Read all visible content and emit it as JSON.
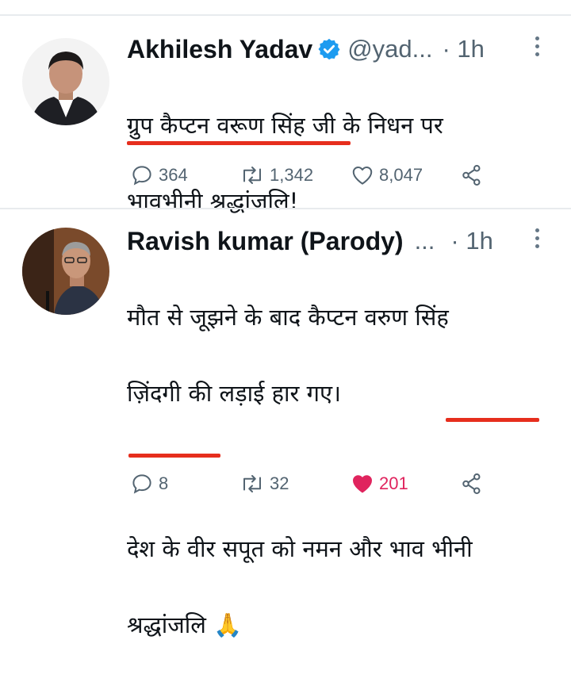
{
  "tweets": [
    {
      "author_name": "Akhilesh Yadav",
      "verified": true,
      "handle": "@yad...",
      "time": "· 1h",
      "text_line1": "ग्रुप कैप्टन वरूण सिंह जी के निधन पर",
      "text_line2": "भावभीनी श्रद्धांजलि!",
      "replies": "364",
      "retweets": "1,342",
      "likes": "8,047",
      "liked": false
    },
    {
      "author_name": "Ravish kumar (Parody)",
      "handle": "...",
      "time": "· 1h",
      "text_line1": "मौत से जूझने के बाद कैप्टन वरुण सिंह",
      "text_line2": "ज़िंदगी की लड़ाई हार गए।",
      "text_line3": "देश के वीर सपूत को नमन और भाव भीनी",
      "text_line4": "श्रद्धांजलि 🙏",
      "replies": "8",
      "retweets": "32",
      "likes": "201",
      "liked": true
    }
  ],
  "colors": {
    "highlight": "#e62e1d",
    "like_active": "#e0245e",
    "verified": "#1d9bf0",
    "muted": "#536471"
  }
}
